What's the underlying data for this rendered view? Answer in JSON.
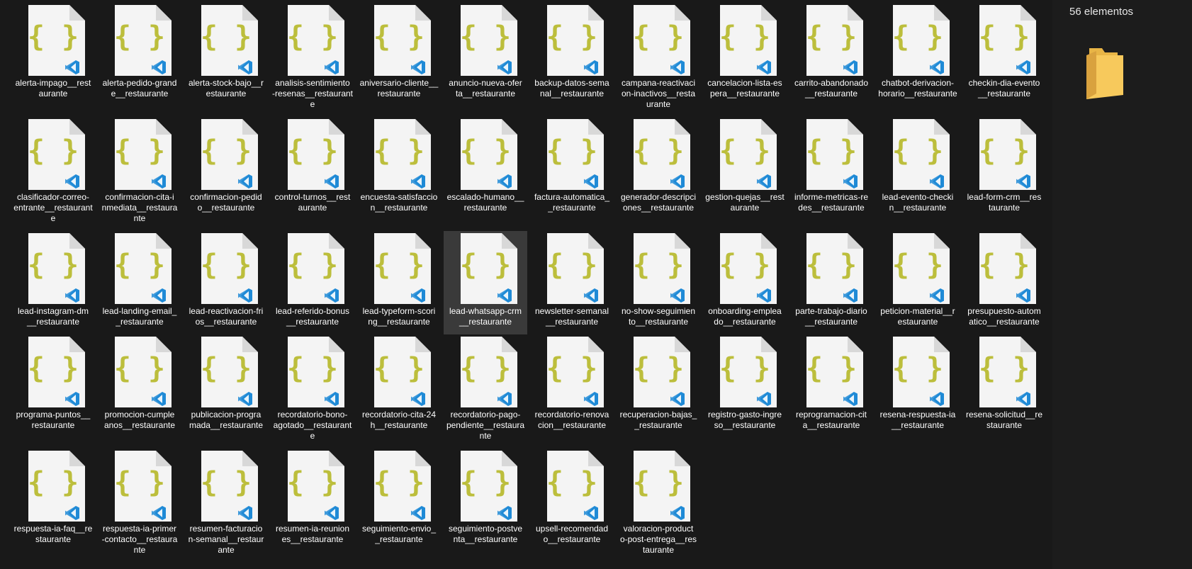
{
  "details": {
    "count_label": "56 elementos"
  },
  "colors": {
    "braces": "#bcbe3c",
    "vscode_blue": "#1f8ad6",
    "selection": "#3a3a3a",
    "folder": "#f7c95c"
  },
  "icons": {
    "file": "json-file-icon",
    "badge": "vscode-icon",
    "folder": "folder-icon"
  },
  "selected": "lead-whatsapp-crm__restaurante",
  "files": [
    {
      "label": "alerta-impago__rest\naurante"
    },
    {
      "label": "alerta-pedido-grand\ne__restaurante"
    },
    {
      "label": "alerta-stock-bajo__r\nestaurante"
    },
    {
      "label": "analisis-sentimiento\n-resenas__restaurant\ne"
    },
    {
      "label": "aniversario-cliente__\nrestaurante"
    },
    {
      "label": "anuncio-nueva-ofer\nta__restaurante"
    },
    {
      "label": "backup-datos-sema\nnal__restaurante"
    },
    {
      "label": "campana-reactivaci\non-inactivos__resta\nurante"
    },
    {
      "label": "cancelacion-lista-es\npera__restaurante"
    },
    {
      "label": "carrito-abandonado\n__restaurante"
    },
    {
      "label": "chatbot-derivacion-\nhorario__restaurante"
    },
    {
      "label": "checkin-dia-evento\n__restaurante"
    },
    {
      "label": "clasificador-correo-\nentrante__restaurant\ne"
    },
    {
      "label": "confirmacion-cita-i\nnmediata__restaura\nnte"
    },
    {
      "label": "confirmacion-pedid\no__restaurante"
    },
    {
      "label": "control-turnos__rest\naurante"
    },
    {
      "label": "encuesta-satisfaccio\nn__restaurante"
    },
    {
      "label": "escalado-humano__\nrestaurante"
    },
    {
      "label": "factura-automatica_\n_restaurante"
    },
    {
      "label": "generador-descripci\nones__restaurante"
    },
    {
      "label": "gestion-quejas__rest\naurante"
    },
    {
      "label": "informe-metricas-re\ndes__restaurante"
    },
    {
      "label": "lead-evento-checki\nn__restaurante"
    },
    {
      "label": "lead-form-crm__res\ntaurante"
    },
    {
      "label": "lead-instagram-dm\n__restaurante"
    },
    {
      "label": "lead-landing-email_\n_restaurante"
    },
    {
      "label": "lead-reactivacion-fri\nos__restaurante"
    },
    {
      "label": "lead-referido-bonus\n__restaurante"
    },
    {
      "label": "lead-typeform-scori\nng__restaurante"
    },
    {
      "label": "lead-whatsapp-crm\n__restaurante"
    },
    {
      "label": "newsletter-semanal\n__restaurante"
    },
    {
      "label": "no-show-seguimien\nto__restaurante"
    },
    {
      "label": "onboarding-emplea\ndo__restaurante"
    },
    {
      "label": "parte-trabajo-diario\n__restaurante"
    },
    {
      "label": "peticion-material__r\nestaurante"
    },
    {
      "label": "presupuesto-autom\natico__restaurante"
    },
    {
      "label": "programa-puntos__\nrestaurante"
    },
    {
      "label": "promocion-cumple\nanos__restaurante"
    },
    {
      "label": "publicacion-progra\nmada__restaurante"
    },
    {
      "label": "recordatorio-bono-\nagotado__restaurant\ne"
    },
    {
      "label": "recordatorio-cita-24\nh__restaurante"
    },
    {
      "label": "recordatorio-pago-\npendiente__restaura\nnte"
    },
    {
      "label": "recordatorio-renova\ncion__restaurante"
    },
    {
      "label": "recuperacion-bajas_\n_restaurante"
    },
    {
      "label": "registro-gasto-ingre\nso__restaurante"
    },
    {
      "label": "reprogramacion-cit\na__restaurante"
    },
    {
      "label": "resena-respuesta-ia\n__restaurante"
    },
    {
      "label": "resena-solicitud__re\nstaurante"
    },
    {
      "label": "respuesta-ia-faq__re\nstaurante"
    },
    {
      "label": "respuesta-ia-primer\n-contacto__restaura\nnte"
    },
    {
      "label": "resumen-facturacio\nn-semanal__restaur\nante"
    },
    {
      "label": "resumen-ia-reunion\nes__restaurante"
    },
    {
      "label": "seguimiento-envio_\n_restaurante"
    },
    {
      "label": "seguimiento-postve\nnta__restaurante"
    },
    {
      "label": "upsell-recomendad\no__restaurante"
    },
    {
      "label": "valoracion-product\no-post-entrega__res\ntaurante"
    }
  ]
}
